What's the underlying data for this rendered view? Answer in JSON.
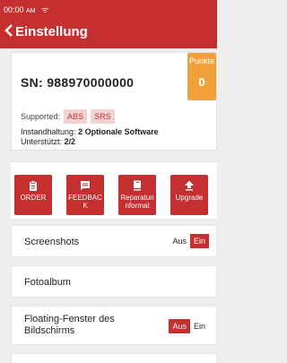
{
  "status": {
    "time": "00:00",
    "ampm": "AM",
    "wifi": "ᯤ"
  },
  "header": {
    "back": "<",
    "title": "Einstellung"
  },
  "device": {
    "sn_label": "SN:",
    "sn_value": "988970000000",
    "points_label": "Punkte",
    "points_value": "0",
    "supported_label": "Supported:",
    "supported_badges": [
      "ABS",
      "SRS"
    ],
    "maintenance_label": "Instandhaltung:",
    "maintenance_value": "2 Optionale Software",
    "support_label": "Unterstützt:",
    "support_value": "2/2"
  },
  "actions": [
    {
      "label": "ORDER",
      "icon": "clipboard-icon"
    },
    {
      "label": "FEEDBACK",
      "icon": "chat-icon"
    },
    {
      "label": "Reparaturinformat",
      "icon": "book-icon"
    },
    {
      "label": "Upgrade",
      "icon": "upload-icon"
    }
  ],
  "settings": {
    "screenshots": {
      "label": "Screenshots",
      "off": "Aus",
      "on": "Ein",
      "selected": "on"
    },
    "photo_album": {
      "label": "Fotoalbum"
    },
    "floating": {
      "label": "Floating-Fenster des Bildschirms",
      "off": "Aus",
      "on": "Ein",
      "selected": "off"
    }
  },
  "colors": {
    "brand": "#c62f2f",
    "points": "#f2a13a",
    "badge_bg": "#f3d2d2"
  }
}
